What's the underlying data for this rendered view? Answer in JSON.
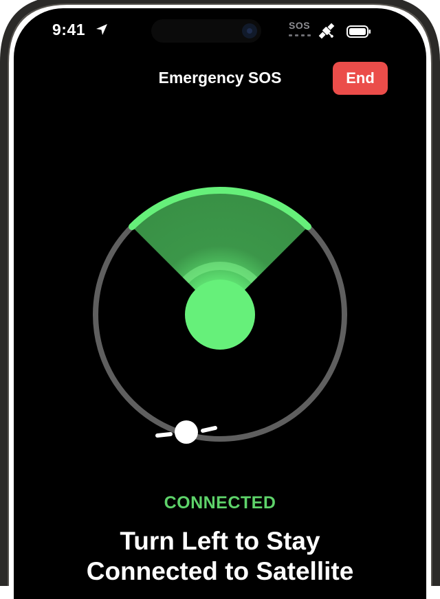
{
  "status_bar": {
    "time": "9:41",
    "sos_label": "SOS",
    "icons": [
      "location-arrow-icon",
      "satellite-icon",
      "battery-icon"
    ]
  },
  "header": {
    "title": "Emergency SOS",
    "end_label": "End"
  },
  "satellite_view": {
    "status": "CONNECTED",
    "instruction_line1": "Turn Left to Stay",
    "instruction_line2": "Connected to Satellite"
  },
  "colors": {
    "accent_green": "#66f07a",
    "status_green": "#5ed36a",
    "end_red": "#eb4d4a",
    "ring_gray": "#5f5f5f",
    "background": "#000000"
  }
}
